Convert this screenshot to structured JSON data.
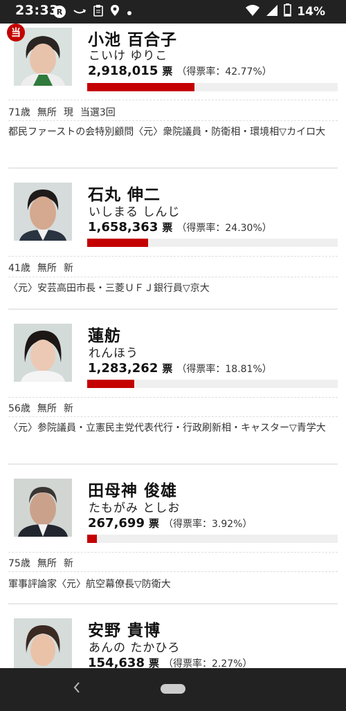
{
  "status_bar": {
    "time": "23:33",
    "badge": "R",
    "battery": "14%",
    "icons": [
      "r-badge-icon",
      "amazon-icon",
      "clipboard-icon",
      "location-icon",
      "dot-icon",
      "wifi-icon",
      "signal-icon",
      "battery-icon"
    ]
  },
  "elected_badge": "当",
  "candidates": [
    {
      "name": "小池 百合子",
      "kana": "こいけ ゆりこ",
      "votes": "2,918,015",
      "unit": "票",
      "rate": "（得票率：42.77%）",
      "share": 0.4277,
      "age": "71歳",
      "party": "無所",
      "status": "現",
      "elected_count": "当選3回",
      "career": "都民ファーストの会特別顧問〈元〉衆院議員・防衛相・環境相▽カイロ大"
    },
    {
      "name": "石丸 伸二",
      "kana": "いしまる しんじ",
      "votes": "1,658,363",
      "unit": "票",
      "rate": "（得票率：24.30%）",
      "share": 0.243,
      "age": "41歳",
      "party": "無所",
      "status": "新",
      "elected_count": "",
      "career": "〈元〉安芸高田市長・三菱ＵＦＪ銀行員▽京大"
    },
    {
      "name": "蓮舫",
      "kana": "れんほう",
      "votes": "1,283,262",
      "unit": "票",
      "rate": "（得票率：18.81%）",
      "share": 0.1881,
      "age": "56歳",
      "party": "無所",
      "status": "新",
      "elected_count": "",
      "career": "〈元〉参院議員・立憲民主党代表代行・行政刷新相・キャスター▽青学大"
    },
    {
      "name": "田母神 俊雄",
      "kana": "たもがみ としお",
      "votes": "267,699",
      "unit": "票",
      "rate": "（得票率：3.92%）",
      "share": 0.0392,
      "age": "75歳",
      "party": "無所",
      "status": "新",
      "elected_count": "",
      "career": "軍事評論家〈元〉航空幕僚長▽防衛大"
    },
    {
      "name": "安野 貴博",
      "kana": "あんの たかひろ",
      "votes": "154,638",
      "unit": "票",
      "rate": "（得票率：2.27%）",
      "share": 0.0227,
      "age": "",
      "party": "",
      "status": "",
      "elected_count": "",
      "career": ""
    }
  ],
  "nav": {
    "back_icon": "back-chevron-icon",
    "home_icon": "home-pill-icon"
  }
}
